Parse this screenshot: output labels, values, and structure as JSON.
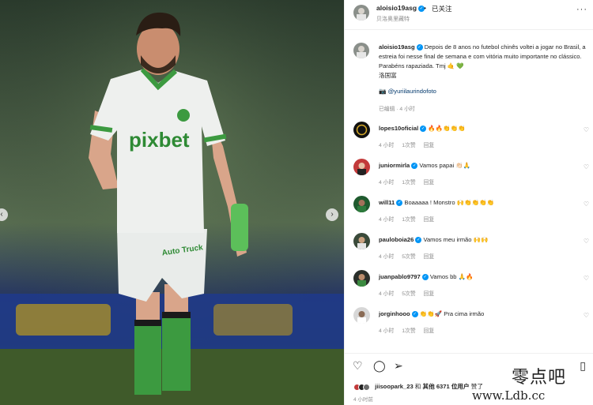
{
  "post_author": {
    "username": "aloisio19asg",
    "follow_status": "已关注",
    "separator": "•",
    "subtitle": "贝洛奥里藏特"
  },
  "caption": {
    "username": "aloisio19asg",
    "text": "Depois de 8 anos no futebol chinês voltei a jogar no Brasil, a estreia foi nesse final de semana e com vitória muito importante no clássico. Parabéns rapaziada. Tmj 🤙 💚",
    "chinese_line": "洛国富",
    "photo_credit": "📷 @yuriilaurindofoto",
    "edited_time": "已编辑 · 4 小时"
  },
  "comments": [
    {
      "username": "lopes10oficial",
      "verified": true,
      "text": "🔥🔥👏👏👏",
      "time": "4 小时",
      "likes": "1次赞",
      "reply": "回复"
    },
    {
      "username": "juniormirla",
      "verified": true,
      "text": "Vamos papai 👏🏻🙏",
      "time": "4 小时",
      "likes": "1次赞",
      "reply": "回复"
    },
    {
      "username": "will11",
      "verified": true,
      "text": "Boaaaaa ! Monstro 🙌👏👏👏👏",
      "time": "4 小时",
      "likes": "1次赞",
      "reply": "回复"
    },
    {
      "username": "pauloboia26",
      "verified": true,
      "text": "Vamos meu irmão 🙌🙌",
      "time": "4 小时",
      "likes": "5次赞",
      "reply": "回复"
    },
    {
      "username": "juanpablo9797",
      "verified": true,
      "text": "Vamos bb 🙏🔥",
      "time": "4 小时",
      "likes": "5次赞",
      "reply": "回复"
    },
    {
      "username": "jorginhooo",
      "verified": true,
      "text": "👏👏🚀 Pra cima irmão",
      "time": "4 小时",
      "likes": "1次赞",
      "reply": "回复"
    }
  ],
  "likes": {
    "prefix_user": "jiisoopark_23",
    "middle": "和",
    "others": "其他 6371 位用户",
    "suffix": "赞了"
  },
  "post_time": "4 小时前",
  "icons": {
    "like": "heart-icon",
    "comment": "comment-icon",
    "share": "share-icon",
    "save": "bookmark-icon",
    "more": "more-icon",
    "next": "chevron-right-icon",
    "prev": "chevron-left-icon"
  },
  "jersey": {
    "sponsor": "pixbet",
    "sleeve_sponsor": "Auto Truck"
  },
  "watermark": {
    "top": "零点吧",
    "bottom": "www.Ldb.cc"
  },
  "colors": {
    "verified": "#0095f6",
    "heart_green": "#2bb34a",
    "jersey_green": "#3e9a3a"
  }
}
